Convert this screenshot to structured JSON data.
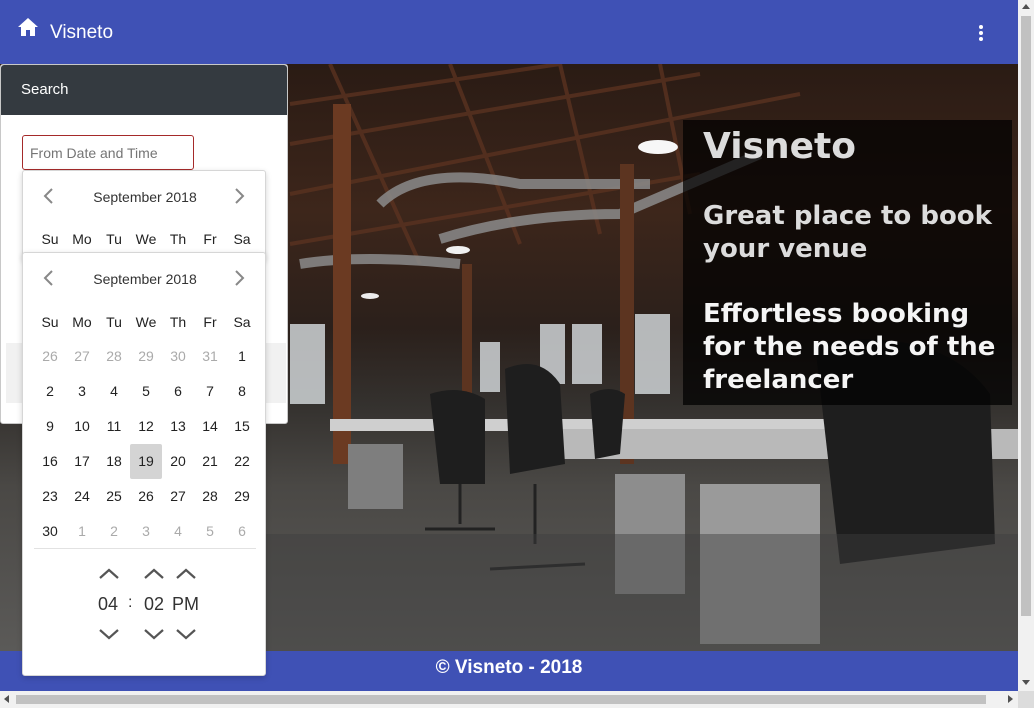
{
  "header": {
    "brand": "Visneto",
    "home_icon": "home-icon",
    "menu_icon": "more-vert-icon",
    "color": "#3f51b5"
  },
  "search": {
    "title": "Search",
    "from_placeholder": "From Date and Time"
  },
  "datepicker": {
    "month_label": "September 2018",
    "weekdays": [
      "Su",
      "Mo",
      "Tu",
      "We",
      "Th",
      "Fr",
      "Sa"
    ],
    "weeks": [
      [
        "26",
        "27",
        "28",
        "29",
        "30",
        "31",
        "1"
      ],
      [
        "2",
        "3",
        "4",
        "5",
        "6",
        "7",
        "8"
      ],
      [
        "9",
        "10",
        "11",
        "12",
        "13",
        "14",
        "15"
      ],
      [
        "16",
        "17",
        "18",
        "19",
        "20",
        "21",
        "22"
      ],
      [
        "23",
        "24",
        "25",
        "26",
        "27",
        "28",
        "29"
      ],
      [
        "30",
        "1",
        "2",
        "3",
        "4",
        "5",
        "6"
      ]
    ],
    "selected_day": "19",
    "time": {
      "hours": "04",
      "separator": ":",
      "minutes": "02",
      "period": "PM"
    }
  },
  "hero": {
    "title": "Visneto",
    "line1": "Great place to book your venue",
    "line2": "Effortless booking for the needs of the freelancer"
  },
  "footer": {
    "text": "© Visneto - 2018"
  }
}
